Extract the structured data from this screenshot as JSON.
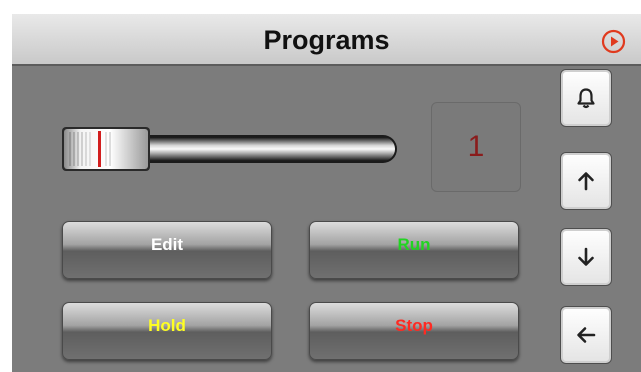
{
  "header": {
    "title": "Programs",
    "play_icon": "play-circle-icon",
    "accent": "#e03a1e"
  },
  "program": {
    "number": "1",
    "slider_position": 0.0
  },
  "buttons": {
    "edit": "Edit",
    "run": "Run",
    "hold": "Hold",
    "stop": "Stop"
  },
  "button_colors": {
    "edit": "#ffffff",
    "run": "#22d422",
    "hold": "#ffff22",
    "stop": "#ff2a22"
  },
  "side_buttons": [
    "bell-icon",
    "arrow-up-icon",
    "arrow-down-icon",
    "arrow-left-icon"
  ]
}
